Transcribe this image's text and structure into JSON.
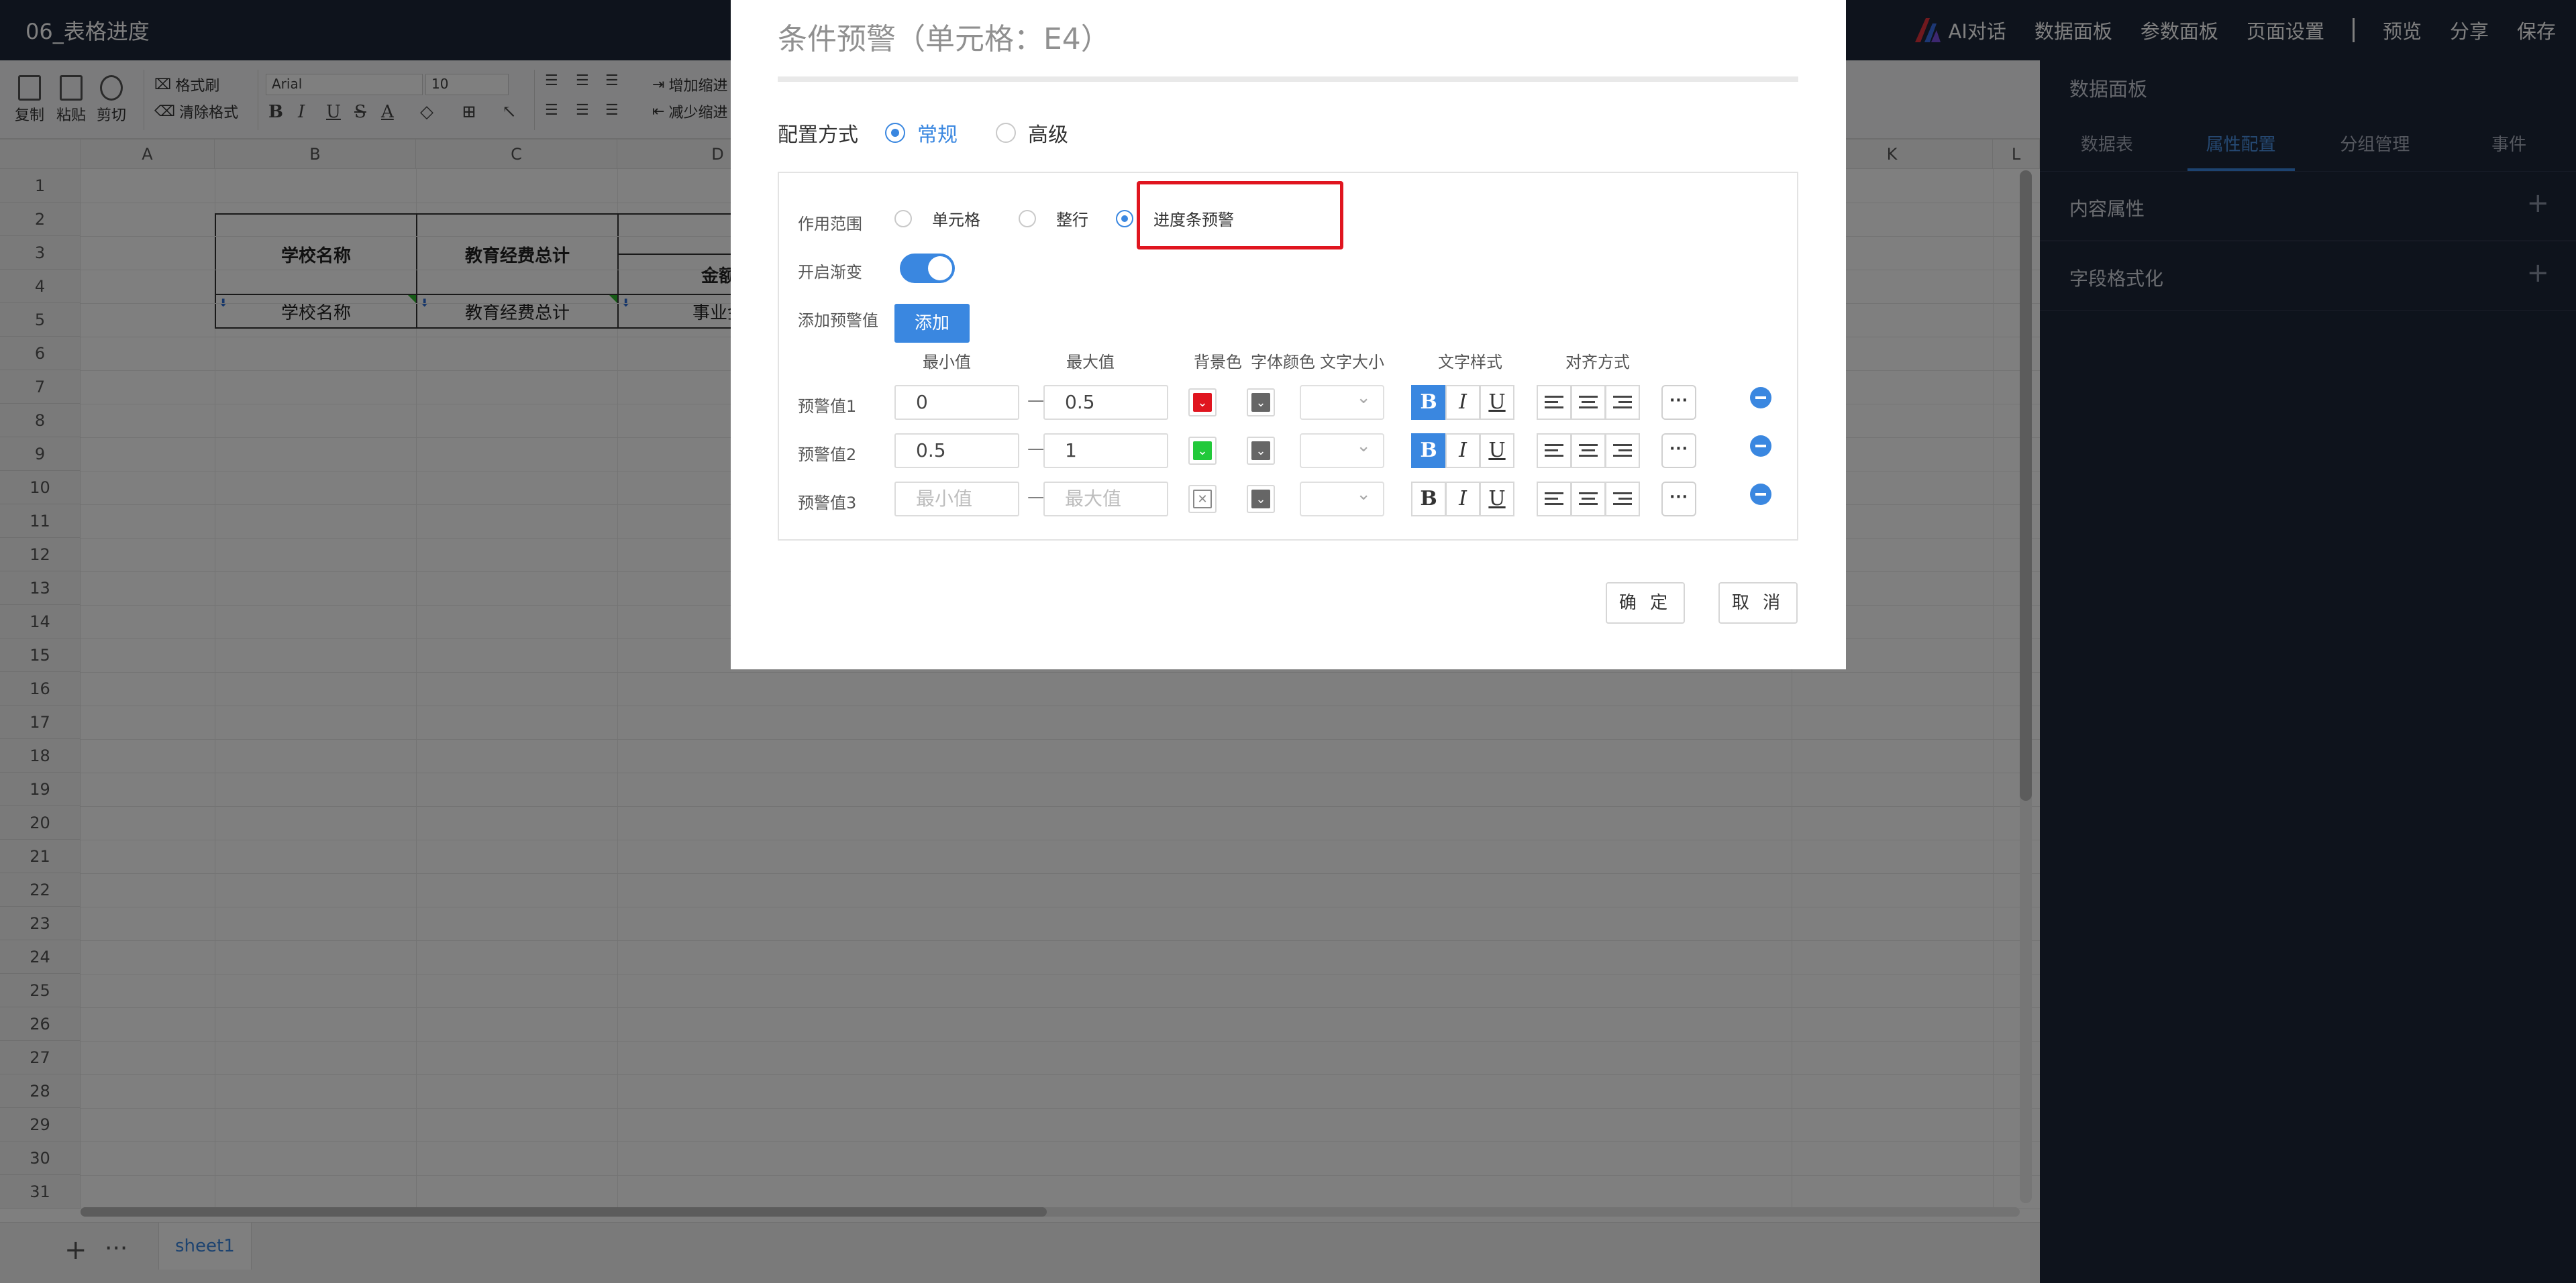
{
  "doc_title": "06_表格进度",
  "topnav": {
    "ai_label": "AI对话",
    "items": [
      "数据面板",
      "参数面板",
      "页面设置"
    ],
    "right_items": [
      "预览",
      "分享",
      "保存"
    ]
  },
  "toolbar": {
    "copy": "复制",
    "paste": "粘贴",
    "cut": "剪切",
    "format_painter": "格式刷",
    "clear_format": "清除格式",
    "font": "Arial",
    "font_size": "10",
    "increase_indent": "增加缩进",
    "decrease_indent": "减少缩进"
  },
  "grid": {
    "columns": [
      "A",
      "B",
      "C",
      "D",
      "K",
      "L"
    ],
    "rows": [
      "1",
      "2",
      "3",
      "4",
      "5",
      "6",
      "7",
      "8",
      "9",
      "10",
      "11",
      "12",
      "13",
      "14",
      "15",
      "16",
      "17",
      "18",
      "19",
      "20",
      "21",
      "22",
      "23",
      "24",
      "25",
      "26",
      "27",
      "28",
      "29",
      "30",
      "31"
    ],
    "cells": {
      "b2": "学校名称",
      "c2": "教育经费总计",
      "d3": "金额",
      "b4": "学校名称",
      "c4": "教育经费总计",
      "d4": "事业金"
    }
  },
  "sheetbar": {
    "add": "+",
    "more": "···",
    "tab": "sheet1"
  },
  "right_panel": {
    "title": "数据面板",
    "tabs": [
      "数据表",
      "属性配置",
      "分组管理",
      "事件"
    ],
    "active_tab": "属性配置",
    "sections": [
      "内容属性",
      "字段格式化"
    ]
  },
  "dialog": {
    "title": "条件预警（单元格：E4）",
    "config_label": "配置方式",
    "config_options": [
      "常规",
      "高级"
    ],
    "config_selected": "常规",
    "scope_label": "作用范围",
    "scope_options": [
      "单元格",
      "整行",
      "进度条预警"
    ],
    "scope_selected": "进度条预警",
    "gradient_label": "开启渐变",
    "gradient_on": true,
    "add_label": "添加预警值",
    "add_button": "添加",
    "columns": [
      "最小值",
      "最大值",
      "背景色",
      "字体颜色",
      "文字大小",
      "文字样式",
      "对齐方式"
    ],
    "rows": [
      {
        "label": "预警值1",
        "min": "0",
        "max": "0.5",
        "bg": "#e0151f",
        "bold": true
      },
      {
        "label": "预警值2",
        "min": "0.5",
        "max": "1",
        "bg": "#22c93a",
        "bold": true
      },
      {
        "label": "预警值3",
        "min": "",
        "max": "",
        "bg": "none",
        "bold": false
      }
    ],
    "min_placeholder": "最小值",
    "max_placeholder": "最大值",
    "confirm": "确 定",
    "cancel": "取 消"
  }
}
